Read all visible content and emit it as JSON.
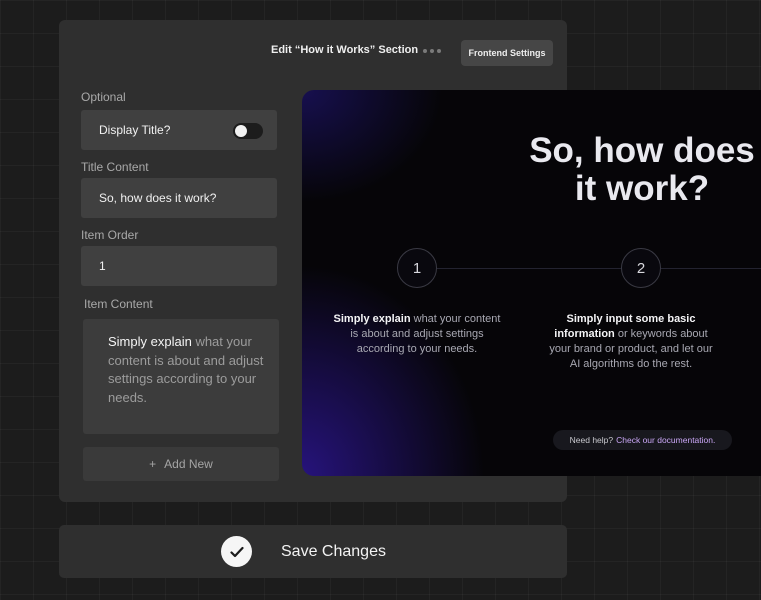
{
  "panel": {
    "title": "Edit “How it Works” Section",
    "menu_icon": "more-dots-icon",
    "frontend_settings_label": "Frontend Settings"
  },
  "form": {
    "optional_label": "Optional",
    "display_title_label": "Display Title?",
    "display_title_toggle": "off",
    "title_content_label": "Title Content",
    "title_content_value": "So, how does it work?",
    "item_order_label": "Item Order",
    "item_order_value": "1",
    "item_content_label": "Item Content",
    "item_content_strong": "Simply explain",
    "item_content_rest": " what your content is about and adjust settings according to your needs.",
    "add_new_icon": "plus-icon",
    "add_new_label": "Add New"
  },
  "preview": {
    "title_line1": "So, how does",
    "title_line2": "it work?",
    "steps": [
      {
        "number": "1",
        "strong": "Simply explain",
        "rest": " what your content is about and adjust settings according to your needs."
      },
      {
        "number": "2",
        "strong": "Simply input some basic information",
        "rest": " or keywords about your brand or product, and let our AI algorithms do the rest."
      }
    ],
    "help_text": "Need help?",
    "help_link": "Check our documentation."
  },
  "save": {
    "icon": "checkmark-icon",
    "label": "Save Changes"
  },
  "colors": {
    "background": "#1c1c1c",
    "panel": "#2f2f2f",
    "field": "#404040",
    "accent_link": "#c9a6f5",
    "preview_glow": "#2814a0"
  }
}
